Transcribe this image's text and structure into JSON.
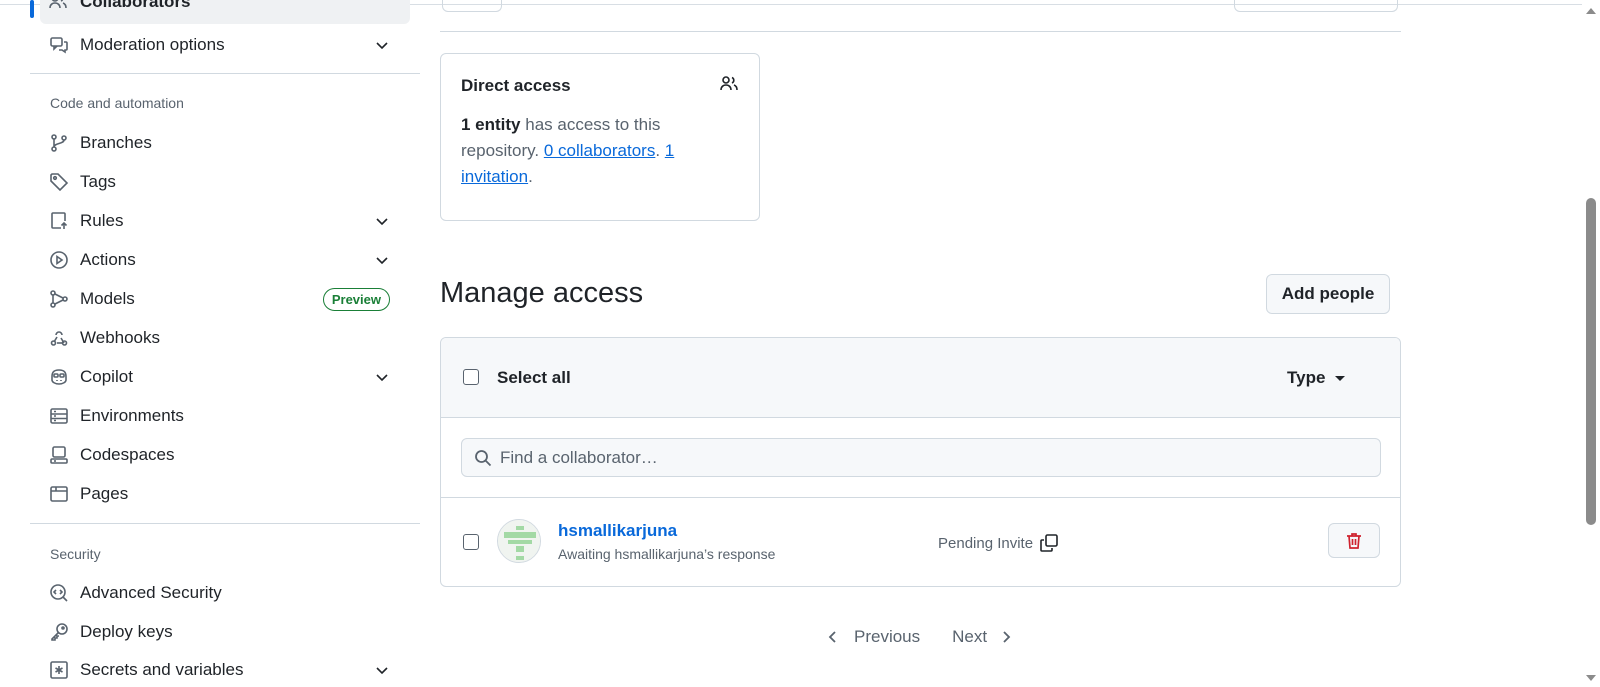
{
  "sidebar": {
    "active_item": "Collaborators",
    "moderation": "Moderation options",
    "section_code": "Code and automation",
    "items": [
      {
        "label": "Branches"
      },
      {
        "label": "Tags"
      },
      {
        "label": "Rules"
      },
      {
        "label": "Actions"
      },
      {
        "label": "Models",
        "badge": "Preview"
      },
      {
        "label": "Webhooks"
      },
      {
        "label": "Copilot"
      },
      {
        "label": "Environments"
      },
      {
        "label": "Codespaces"
      },
      {
        "label": "Pages"
      }
    ],
    "section_security": "Security",
    "security_items": [
      {
        "label": "Advanced Security"
      },
      {
        "label": "Deploy keys"
      },
      {
        "label": "Secrets and variables"
      }
    ]
  },
  "direct_access": {
    "title": "Direct access",
    "entity_count": "1 entity",
    "text1": " has access to this repository. ",
    "collaborators_link": "0 collaborators",
    "sep": ". ",
    "invitation_link": "1 invitation",
    "end": "."
  },
  "manage": {
    "title": "Manage access",
    "add_people": "Add people",
    "select_all": "Select all",
    "type_filter": "Type",
    "search_placeholder": "Find a collaborator…",
    "members": [
      {
        "name": "hsmallikarjuna",
        "status": "Awaiting hsmallikarjuna’s response",
        "role": "Pending Invite"
      }
    ]
  },
  "pagination": {
    "previous": "Previous",
    "next": "Next"
  },
  "colors": {
    "accent": "#0969da",
    "preview_badge": "#1a7f37",
    "danger": "#cf222e"
  }
}
